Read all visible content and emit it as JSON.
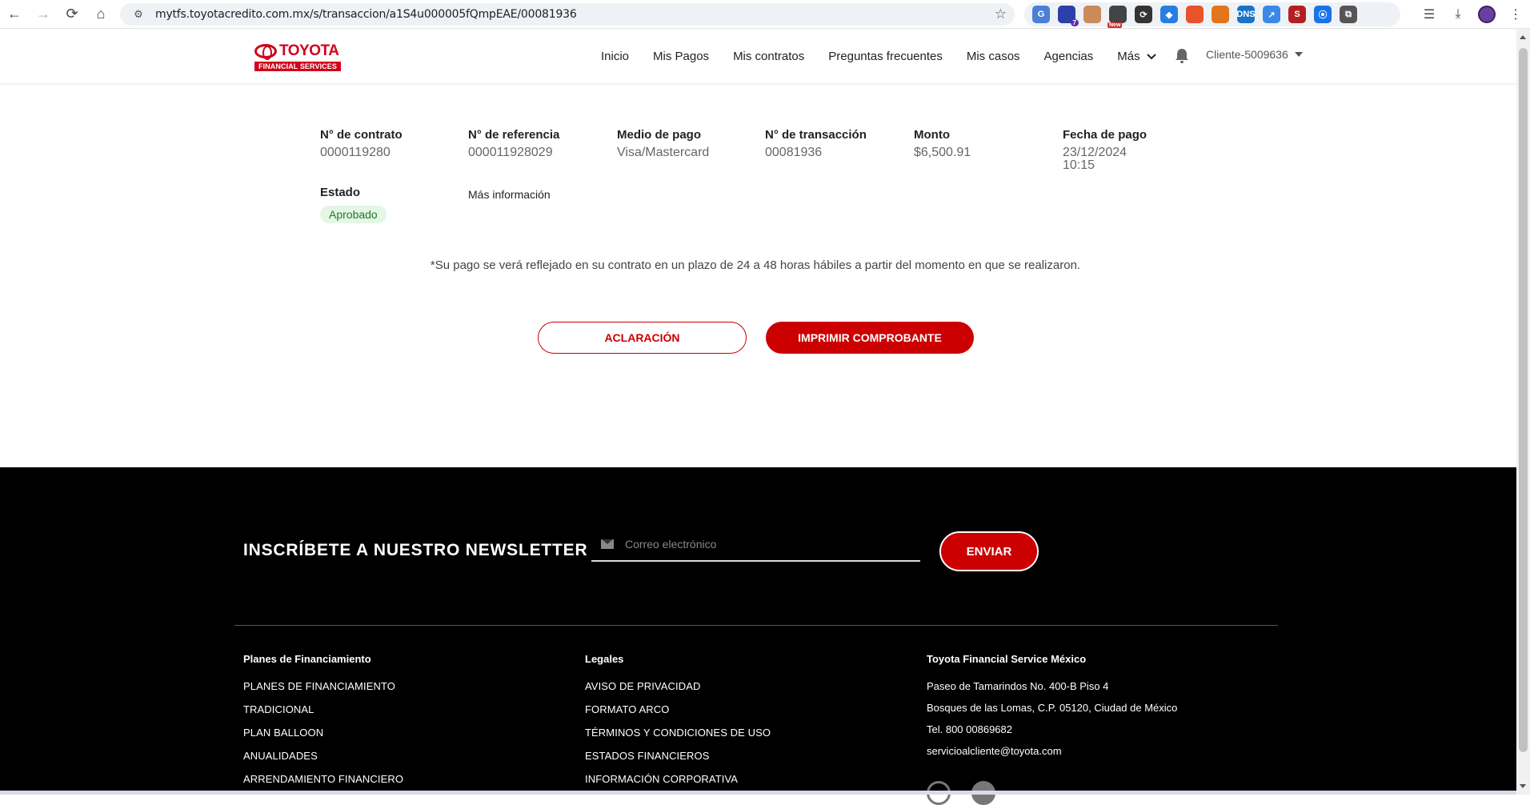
{
  "browser": {
    "url": "mytfs.toyotacredito.com.mx/s/transaccion/a1S4u000005fQmpEAE/00081936",
    "extensions": [
      {
        "name": "translate-extension-icon",
        "color": "#4a7fd6",
        "label": "G"
      },
      {
        "name": "hat-extension-icon",
        "color": "#2d3fa8",
        "label": "",
        "badge": "7"
      },
      {
        "name": "face-extension-icon",
        "color": "#c98b5a",
        "label": ""
      },
      {
        "name": "new-extension-icon",
        "color": "#444",
        "label": "",
        "newbadge": "New"
      },
      {
        "name": "refresh-extension-icon",
        "color": "#333",
        "label": "⟳"
      },
      {
        "name": "tag-extension-icon",
        "color": "#2a7de1",
        "label": "◆"
      },
      {
        "name": "fire-extension-icon",
        "color": "#e8532b",
        "label": ""
      },
      {
        "name": "fox-extension-icon",
        "color": "#e2761b",
        "label": ""
      },
      {
        "name": "dns-extension-icon",
        "color": "#1a73c7",
        "label": "DNS"
      },
      {
        "name": "link-extension-icon",
        "color": "#3b88e8",
        "label": "↗"
      },
      {
        "name": "s-extension-icon",
        "color": "#b32020",
        "label": "S"
      },
      {
        "name": "waves-extension-icon",
        "color": "#1a73e8",
        "label": "⦿"
      },
      {
        "name": "puzzle-extension-icon",
        "color": "#555",
        "label": "⧉"
      }
    ]
  },
  "header": {
    "logo_word": "TOYOTA",
    "logo_sub": "FINANCIAL SERVICES",
    "nav": [
      "Inicio",
      "Mis Pagos",
      "Mis contratos",
      "Preguntas frecuentes",
      "Mis casos",
      "Agencias"
    ],
    "more_label": "Más",
    "client": "Cliente-5009636"
  },
  "transaction": {
    "contract_label": "N° de contrato",
    "contract_value": "0000119280",
    "reference_label": "N° de referencia",
    "reference_value": "000011928029",
    "method_label": "Medio de pago",
    "method_value": "Visa/Mastercard",
    "txn_label": "N° de transacción",
    "txn_value": "00081936",
    "amount_label": "Monto",
    "amount_value": "$6,500.91",
    "date_label": "Fecha de pago",
    "date_value": "23/12/2024",
    "time_value": "10:15",
    "status_label": "Estado",
    "status_value": "Aprobado",
    "more_info": "Más información",
    "notice": "*Su pago se verá reflejado en su contrato en un plazo de 24 a 48 horas hábiles a partir del momento en que se realizaron.",
    "btn_clarify": "ACLARACIÓN",
    "btn_print": "IMPRIMIR COMPROBANTE"
  },
  "footer": {
    "newsletter_title": "INSCRÍBETE A NUESTRO NEWSLETTER",
    "email_placeholder": "Correo electrónico",
    "send": "ENVIAR",
    "col1": {
      "title": "Planes de Financiamiento",
      "links": [
        "PLANES DE FINANCIAMIENTO",
        "TRADICIONAL",
        "PLAN BALLOON",
        "ANUALIDADES",
        "ARRENDAMIENTO FINANCIERO"
      ]
    },
    "col2": {
      "title": "Legales",
      "links": [
        "AVISO DE PRIVACIDAD",
        "FORMATO ARCO",
        "TÉRMINOS Y CONDICIONES DE USO",
        "ESTADOS FINANCIEROS",
        "INFORMACIÓN CORPORATIVA"
      ]
    },
    "col3": {
      "title": "Toyota Financial Service México",
      "address1": "Paseo de Tamarindos No. 400-B Piso 4",
      "address2": "Bosques de las Lomas, C.P. 05120, Ciudad de México",
      "phone": "Tel. 800 00869682",
      "email": "servicioalcliente@toyota.com"
    }
  },
  "colors": {
    "brand_red": "#cc0000",
    "approved_bg": "#e4f6e4",
    "approved_text": "#1f7a2a"
  }
}
